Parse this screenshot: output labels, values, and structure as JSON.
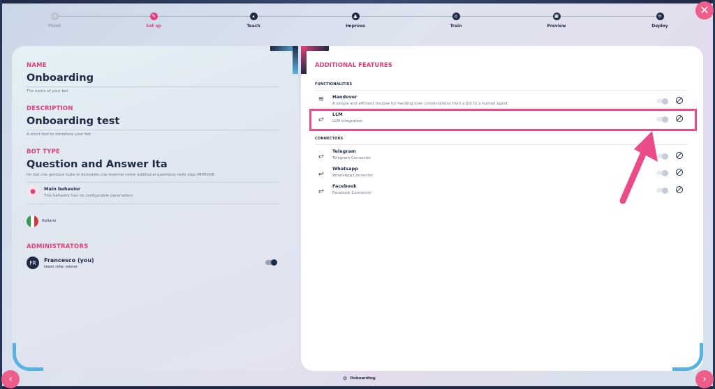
{
  "stepper": {
    "steps": [
      {
        "label": "Think",
        "icon": "clock-icon",
        "state": "done"
      },
      {
        "label": "Set up",
        "icon": "pencil-icon",
        "state": "active"
      },
      {
        "label": "Teach",
        "icon": "graduation-cap-icon",
        "state": "pending"
      },
      {
        "label": "Improve",
        "icon": "triangle-icon",
        "state": "pending"
      },
      {
        "label": "Train",
        "icon": "dumbbell-icon",
        "state": "pending"
      },
      {
        "label": "Preview",
        "icon": "preview-icon",
        "state": "pending"
      },
      {
        "label": "Deploy",
        "icon": "deploy-icon",
        "state": "pending"
      }
    ]
  },
  "bot": {
    "name_label": "NAME",
    "name_value": "Onboarding",
    "name_hint": "The name of your bot",
    "description_label": "DESCRIPTION",
    "description_value": "Onboarding test",
    "description_hint": "A short text to introduce your bot",
    "type_label": "BOT TYPE",
    "type_value": "Question and Answer Ita",
    "type_hint": "Un bot che gestisce tutte le domande che inserirai come additional questions nello step IMPROVE.",
    "behavior_title": "Main behavior",
    "behavior_sub": "This behavior has no configurable parameters",
    "language": "Italiano"
  },
  "administrators": {
    "label": "ADMINISTRATORS",
    "items": [
      {
        "initials": "FR",
        "name": "Francesco (you)",
        "role": "team role: owner",
        "enabled": true
      }
    ]
  },
  "features": {
    "title": "ADDITIONAL FEATURES",
    "functionalities_label": "FUNCTIONALITIES",
    "functionalities": [
      {
        "name": "Handover",
        "desc": "A simple and efficient module for handing over conversations from a bot to a human agent.",
        "icon": "handshake-icon",
        "enabled": false
      },
      {
        "name": "LLM",
        "desc": "LLM integration",
        "icon": "plug-icon",
        "enabled": false
      }
    ],
    "connectors_label": "CONNECTORS",
    "connectors": [
      {
        "name": "Telegram",
        "desc": "Telegram Connector",
        "icon": "plug-icon",
        "enabled": false
      },
      {
        "name": "Whatsapp",
        "desc": "WhatsApp Connector",
        "icon": "plug-icon",
        "enabled": false
      },
      {
        "name": "Facebook",
        "desc": "Facebook Connector",
        "icon": "plug-icon",
        "enabled": false
      }
    ]
  },
  "footer": {
    "bot_label": "Onboarding"
  },
  "colors": {
    "accent": "#e0407a",
    "navy": "#1f2a44",
    "highlight": "#ea4c89"
  }
}
